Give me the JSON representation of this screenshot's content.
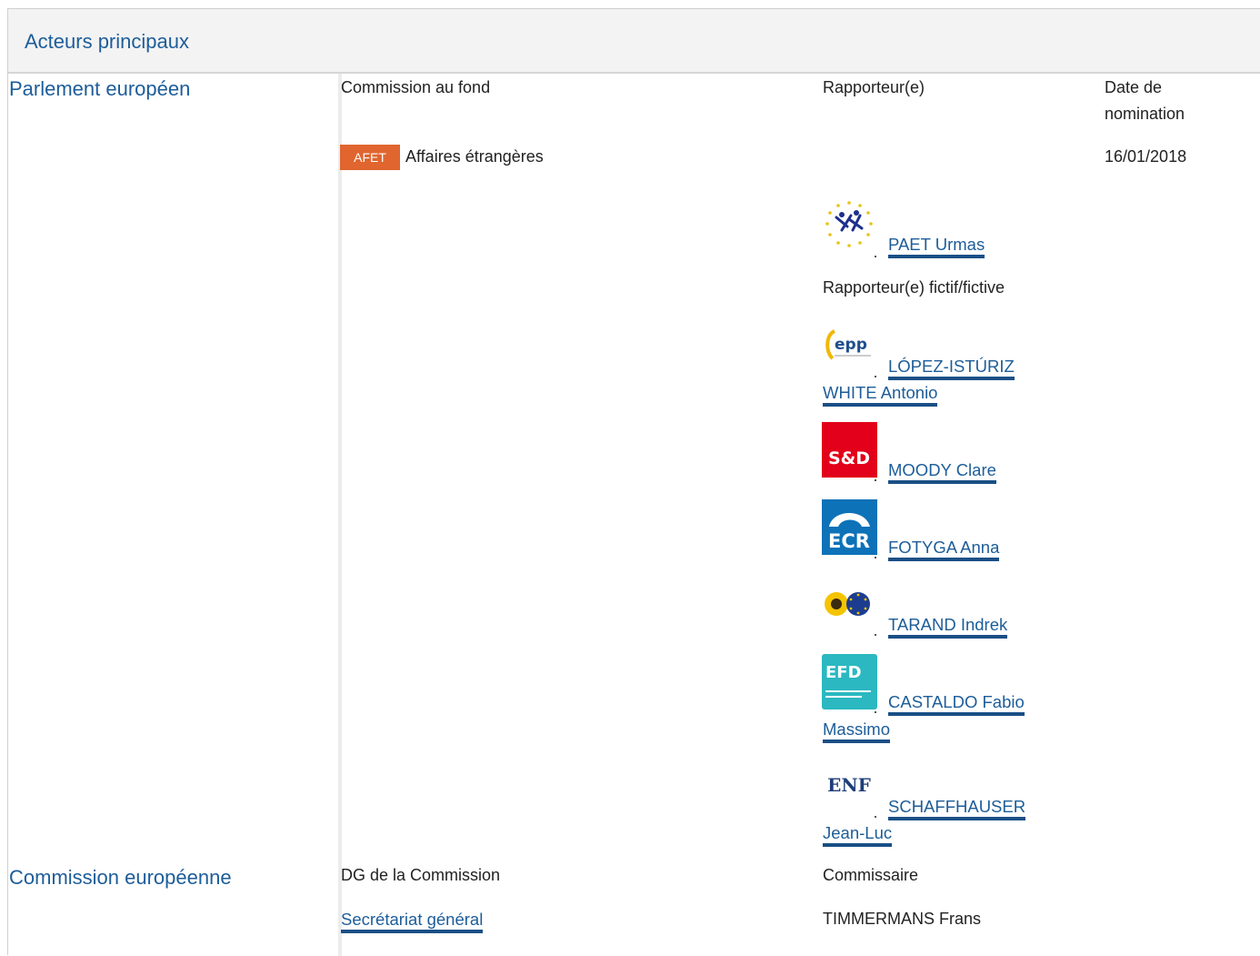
{
  "section": {
    "title": "Acteurs principaux"
  },
  "parliament": {
    "name": "Parlement européen",
    "col_committee": "Commission au fond",
    "col_rapporteur": "Rapporteur(e)",
    "col_date": "Date de nomination",
    "committee_code": "AFET",
    "committee_name": "Affaires étrangères",
    "date": "16/01/2018",
    "rapporteur": {
      "name": "PAET Urmas",
      "group_logo": "alde-logo"
    },
    "shadow_heading": "Rapporteur(e) fictif/fictive",
    "shadows": [
      {
        "line1": "LÓPEZ-ISTÚRIZ",
        "line2": "WHITE Antonio",
        "group_logo": "epp-logo",
        "logo_text": "epp"
      },
      {
        "line1": "MOODY Clare",
        "group_logo": "sd-logo",
        "logo_text": "S&D"
      },
      {
        "line1": "FOTYGA Anna",
        "group_logo": "ecr-logo",
        "logo_text": "ECR"
      },
      {
        "line1": "TARAND Indrek",
        "group_logo": "greens-efa-logo"
      },
      {
        "line1": "CASTALDO Fabio",
        "line2": "Massimo",
        "group_logo": "efdd-logo",
        "logo_text": "EFD"
      },
      {
        "line1": "SCHAFFHAUSER",
        "line2": "Jean-Luc",
        "group_logo": "enf-logo",
        "logo_text": "ENF"
      }
    ]
  },
  "commission": {
    "name": "Commission européenne",
    "col_dg": "DG de la Commission",
    "col_commissioner": "Commissaire",
    "dg": "Secrétariat général",
    "commissioner": "TIMMERMANS Frans"
  },
  "colors": {
    "link": "#1d5d99",
    "badge": "#e0652f",
    "header_bg": "#f3f3f3",
    "sd_red": "#e2001a",
    "ecr_blue": "#0d72b8",
    "efdd_teal": "#2bb8c1"
  }
}
